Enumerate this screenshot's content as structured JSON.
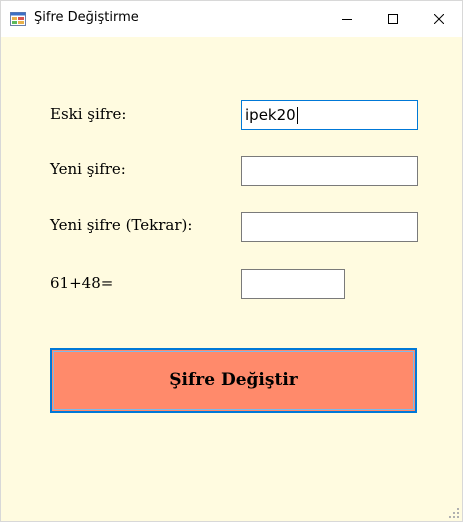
{
  "window": {
    "title": "Şifre Değiştirme",
    "icon": "form-window-icon"
  },
  "titlebar": {
    "minimize": "minimize-icon",
    "maximize": "maximize-icon",
    "close": "close-icon"
  },
  "form": {
    "old_password_label": "Eski şifre:",
    "old_password_value": "ipek20",
    "new_password_label": "Yeni şifre:",
    "new_password_value": "",
    "confirm_password_label": "Yeni şifre (Tekrar):",
    "confirm_password_value": "",
    "captcha_label": "61+48=",
    "captcha_value": ""
  },
  "submit_label": "Şifre Değiştir",
  "colors": {
    "background": "#fffbe0",
    "button": "#ff8a6b",
    "focus_border": "#0078d7"
  }
}
